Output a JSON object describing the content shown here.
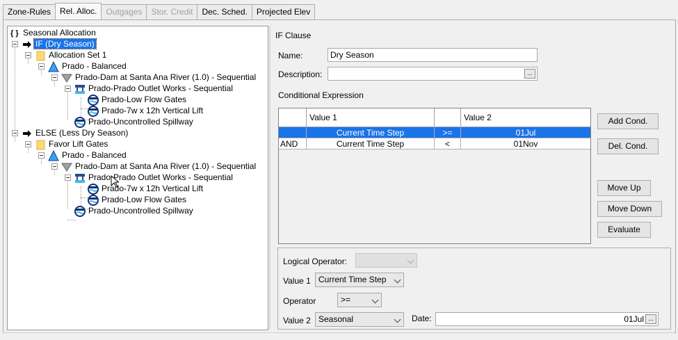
{
  "tabs": [
    {
      "label": "Zone-Rules",
      "state": "normal"
    },
    {
      "label": "Rel. Alloc.",
      "state": "active"
    },
    {
      "label": "Outgages",
      "state": "disabled"
    },
    {
      "label": "Stor. Credit",
      "state": "disabled"
    },
    {
      "label": "Dec. Sched.",
      "state": "normal"
    },
    {
      "label": "Projected Elev",
      "state": "normal"
    }
  ],
  "tree": {
    "root": "Seasonal Allocation",
    "nodes": [
      "IF (Dry Season)",
      "Allocation Set 1",
      "Prado - Balanced",
      "Prado-Dam at Santa Ana River (1.0) - Sequential",
      "Prado-Prado Outlet Works - Sequential",
      "Prado-Low Flow Gates",
      "Prado-7w x 12h Vertical Lift",
      "Prado-Uncontrolled Spillway",
      "ELSE (Less Dry Season)",
      "Favor Lift Gates",
      "Prado - Balanced",
      "Prado-Dam at Santa Ana River (1.0) - Sequential",
      "Prado-Prado Outlet Works - Sequential",
      "Prado-7w x 12h Vertical Lift",
      "Prado-Low Flow Gates",
      "Prado-Uncontrolled Spillway"
    ]
  },
  "if_clause": {
    "title": "IF Clause",
    "name_label": "Name:",
    "name_value": "Dry Season",
    "description_label": "Description:",
    "description_value": "",
    "ellipsis": "..."
  },
  "conditional": {
    "title": "Conditional Expression",
    "headers": [
      "",
      "Value 1",
      "",
      "Value 2"
    ],
    "rows": [
      [
        "",
        "Current Time Step",
        ">=",
        "01Jul"
      ],
      [
        "AND",
        "Current Time Step",
        "<",
        "01Nov"
      ]
    ]
  },
  "buttons": {
    "add_cond": "Add Cond.",
    "del_cond": "Del. Cond.",
    "move_up": "Move Up",
    "move_down": "Move Down",
    "evaluate": "Evaluate"
  },
  "editor": {
    "logical_operator_label": "Logical Operator:",
    "logical_operator_value": "",
    "value1_label": "Value 1",
    "value1_value": "Current Time Step",
    "operator_label": "Operator",
    "operator_value": ">=",
    "value2_label": "Value 2",
    "value2_value": "Seasonal",
    "date_label": "Date:",
    "date_value": "01Jul",
    "ellipsis": "..."
  },
  "colors": {
    "selection": "#1a73e8"
  }
}
